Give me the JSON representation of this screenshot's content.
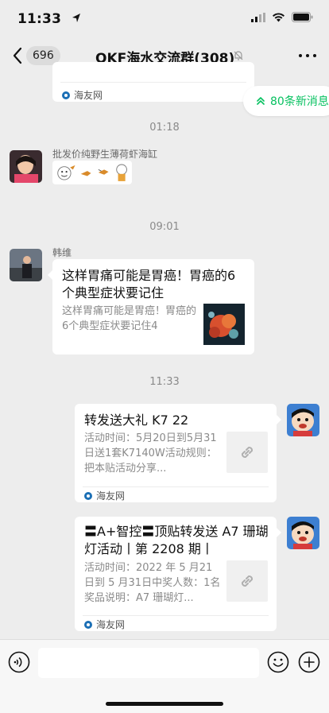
{
  "status": {
    "time": "11:33"
  },
  "nav": {
    "back_count": "696",
    "title": "OKF海水交流群(308)"
  },
  "new_messages": {
    "label": "80条新消息"
  },
  "messages": [
    {
      "type": "card-fragment",
      "source": "海友网"
    },
    {
      "type": "timestamp",
      "text": "01:18"
    },
    {
      "type": "sticker",
      "sender": "批发价纯野生薄荷虾海缸"
    },
    {
      "type": "timestamp",
      "text": "09:01"
    },
    {
      "type": "article",
      "sender": "韩维",
      "title": "这样胃痛可能是胃癌！胃癌的6个典型症状要记住",
      "desc": "这样胃痛可能是胃癌！胃癌的6个典型症状要记住4"
    },
    {
      "type": "timestamp",
      "text": "11:33"
    },
    {
      "type": "link",
      "title": "转发送大礼 K7 22",
      "desc": "活动时间：5月20日到5月31日送1套K7140W活动规则：把本贴活动分享...",
      "source": "海友网"
    },
    {
      "type": "link",
      "title": "〓A+智控〓顶贴转发送 A7 珊瑚灯活动丨第 2208 期丨",
      "desc": "活动时间：2022 年 5 月21日到 5 月31日中奖人数：1名奖品说明：A7 珊瑚灯...",
      "source": "海友网"
    }
  ],
  "input": {
    "value": ""
  }
}
